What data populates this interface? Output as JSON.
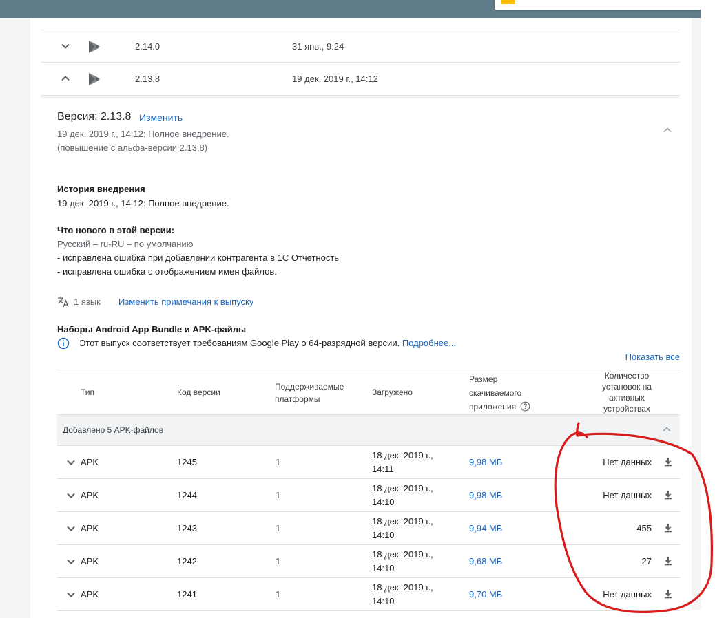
{
  "releases": [
    {
      "version": "2.14.0",
      "date": "31 янв., 9:24"
    },
    {
      "version": "2.13.8",
      "date": "19 дек. 2019 г., 14:12"
    }
  ],
  "detail": {
    "title": "Версия: 2.13.8",
    "edit_label": "Изменить",
    "line1": "19 дек. 2019 г., 14:12: Полное внедрение.",
    "line2": "(повышение с альфа-версии 2.13.8)",
    "history_heading": "История внедрения",
    "history_text": "19 дек. 2019 г., 14:12: Полное внедрение.",
    "whats_new_heading": "Что нового в этой версии:",
    "whats_new_lang": "Русский – ru-RU – по умолчанию",
    "whats_new_items": [
      "- исправлена ошибка при добавлении контрагента в 1С Отчетность",
      "- исправлена ошибка с отображением имен файлов."
    ],
    "lang_count": "1 язык",
    "edit_notes_link": "Изменить примечания к выпуску",
    "bundles_heading": "Наборы Android App Bundle и APK-файлы",
    "info_text": "Этот выпуск соответствует требованиям Google Play о 64-разрядной версии.",
    "info_link": "Подробнее...",
    "show_all": "Показать все"
  },
  "table": {
    "headers": {
      "type": "Тип",
      "code": "Код версии",
      "platforms_1": "Поддерживаемые",
      "platforms_2": "платформы",
      "uploaded": "Загружено",
      "size_1": "Размер",
      "size_2": "скачиваемого",
      "size_3": "приложения",
      "inst_1": "Количество",
      "inst_2": "установок на",
      "inst_3": "активных",
      "inst_4": "устройствах"
    },
    "group_label": "Добавлено 5 APK-файлов",
    "rows": [
      {
        "type": "APK",
        "code": "1245",
        "platforms": "1",
        "date1": "18 дек. 2019 г.,",
        "date2": "14:11",
        "size": "9,98 МБ",
        "installs": "Нет данных"
      },
      {
        "type": "APK",
        "code": "1244",
        "platforms": "1",
        "date1": "18 дек. 2019 г.,",
        "date2": "14:10",
        "size": "9,98 МБ",
        "installs": "Нет данных"
      },
      {
        "type": "APK",
        "code": "1243",
        "platforms": "1",
        "date1": "18 дек. 2019 г.,",
        "date2": "14:10",
        "size": "9,94 МБ",
        "installs": "455"
      },
      {
        "type": "APK",
        "code": "1242",
        "platforms": "1",
        "date1": "18 дек. 2019 г.,",
        "date2": "14:10",
        "size": "9,68 МБ",
        "installs": "27"
      },
      {
        "type": "APK",
        "code": "1241",
        "platforms": "1",
        "date1": "18 дек. 2019 г.,",
        "date2": "14:10",
        "size": "9,70 МБ",
        "installs": "Нет данных"
      }
    ]
  },
  "colors": {
    "topbar": "#607d8b",
    "link": "#1565c0",
    "annotation": "#d71c1c"
  },
  "icons": [
    "chevron-down-icon",
    "chevron-up-icon",
    "google-play-icon",
    "translate-icon",
    "info-icon",
    "help-icon",
    "download-icon"
  ]
}
